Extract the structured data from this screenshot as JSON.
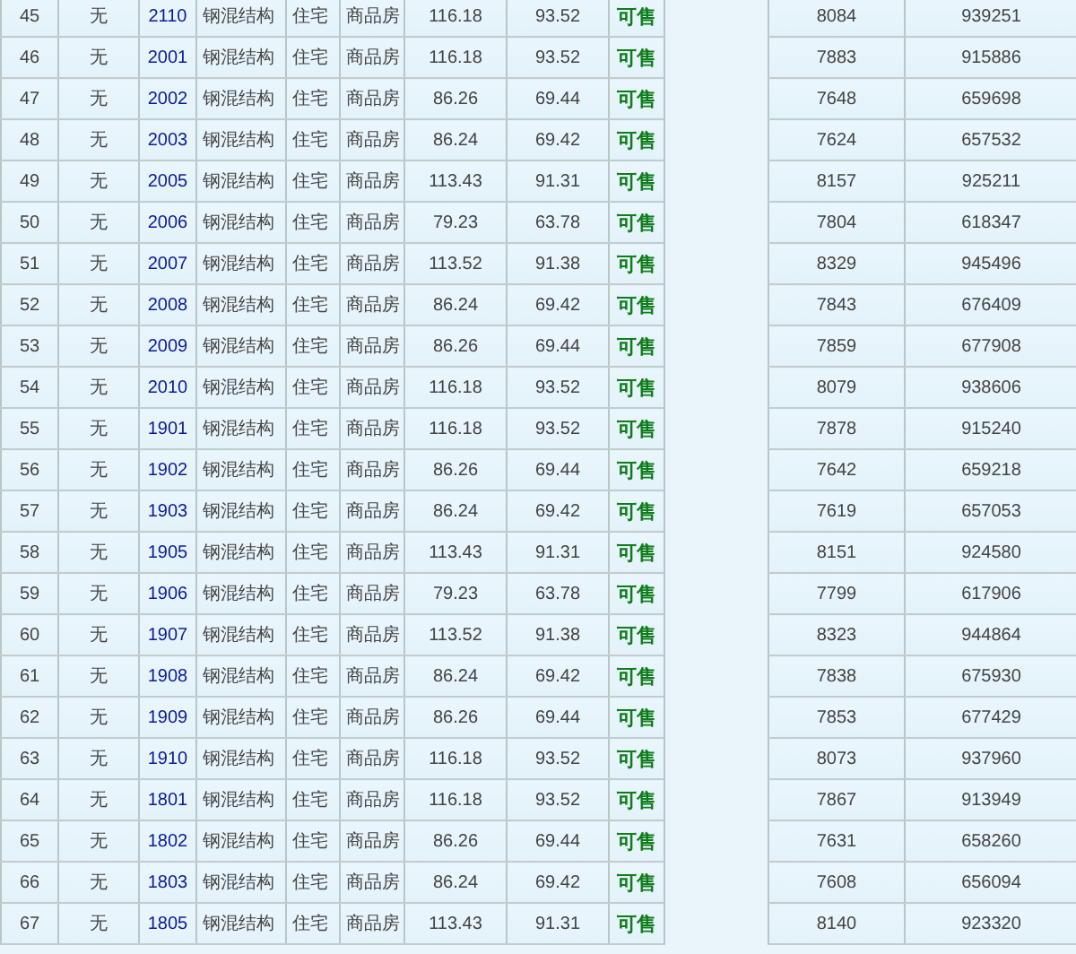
{
  "table": {
    "rows": [
      {
        "cells": [
          "45",
          "无",
          "2110",
          "钢混结构",
          "住宅",
          "商品房",
          "116.18",
          "93.52",
          "可售",
          "8084",
          "939251"
        ]
      },
      {
        "cells": [
          "46",
          "无",
          "2001",
          "钢混结构",
          "住宅",
          "商品房",
          "116.18",
          "93.52",
          "可售",
          "7883",
          "915886"
        ]
      },
      {
        "cells": [
          "47",
          "无",
          "2002",
          "钢混结构",
          "住宅",
          "商品房",
          "86.26",
          "69.44",
          "可售",
          "7648",
          "659698"
        ]
      },
      {
        "cells": [
          "48",
          "无",
          "2003",
          "钢混结构",
          "住宅",
          "商品房",
          "86.24",
          "69.42",
          "可售",
          "7624",
          "657532"
        ]
      },
      {
        "cells": [
          "49",
          "无",
          "2005",
          "钢混结构",
          "住宅",
          "商品房",
          "113.43",
          "91.31",
          "可售",
          "8157",
          "925211"
        ]
      },
      {
        "cells": [
          "50",
          "无",
          "2006",
          "钢混结构",
          "住宅",
          "商品房",
          "79.23",
          "63.78",
          "可售",
          "7804",
          "618347"
        ]
      },
      {
        "cells": [
          "51",
          "无",
          "2007",
          "钢混结构",
          "住宅",
          "商品房",
          "113.52",
          "91.38",
          "可售",
          "8329",
          "945496"
        ]
      },
      {
        "cells": [
          "52",
          "无",
          "2008",
          "钢混结构",
          "住宅",
          "商品房",
          "86.24",
          "69.42",
          "可售",
          "7843",
          "676409"
        ]
      },
      {
        "cells": [
          "53",
          "无",
          "2009",
          "钢混结构",
          "住宅",
          "商品房",
          "86.26",
          "69.44",
          "可售",
          "7859",
          "677908"
        ]
      },
      {
        "cells": [
          "54",
          "无",
          "2010",
          "钢混结构",
          "住宅",
          "商品房",
          "116.18",
          "93.52",
          "可售",
          "8079",
          "938606"
        ]
      },
      {
        "cells": [
          "55",
          "无",
          "1901",
          "钢混结构",
          "住宅",
          "商品房",
          "116.18",
          "93.52",
          "可售",
          "7878",
          "915240"
        ]
      },
      {
        "cells": [
          "56",
          "无",
          "1902",
          "钢混结构",
          "住宅",
          "商品房",
          "86.26",
          "69.44",
          "可售",
          "7642",
          "659218"
        ]
      },
      {
        "cells": [
          "57",
          "无",
          "1903",
          "钢混结构",
          "住宅",
          "商品房",
          "86.24",
          "69.42",
          "可售",
          "7619",
          "657053"
        ]
      },
      {
        "cells": [
          "58",
          "无",
          "1905",
          "钢混结构",
          "住宅",
          "商品房",
          "113.43",
          "91.31",
          "可售",
          "8151",
          "924580"
        ]
      },
      {
        "cells": [
          "59",
          "无",
          "1906",
          "钢混结构",
          "住宅",
          "商品房",
          "79.23",
          "63.78",
          "可售",
          "7799",
          "617906"
        ]
      },
      {
        "cells": [
          "60",
          "无",
          "1907",
          "钢混结构",
          "住宅",
          "商品房",
          "113.52",
          "91.38",
          "可售",
          "8323",
          "944864"
        ]
      },
      {
        "cells": [
          "61",
          "无",
          "1908",
          "钢混结构",
          "住宅",
          "商品房",
          "86.24",
          "69.42",
          "可售",
          "7838",
          "675930"
        ]
      },
      {
        "cells": [
          "62",
          "无",
          "1909",
          "钢混结构",
          "住宅",
          "商品房",
          "86.26",
          "69.44",
          "可售",
          "7853",
          "677429"
        ]
      },
      {
        "cells": [
          "63",
          "无",
          "1910",
          "钢混结构",
          "住宅",
          "商品房",
          "116.18",
          "93.52",
          "可售",
          "8073",
          "937960"
        ]
      },
      {
        "cells": [
          "64",
          "无",
          "1801",
          "钢混结构",
          "住宅",
          "商品房",
          "116.18",
          "93.52",
          "可售",
          "7867",
          "913949"
        ]
      },
      {
        "cells": [
          "65",
          "无",
          "1802",
          "钢混结构",
          "住宅",
          "商品房",
          "86.26",
          "69.44",
          "可售",
          "7631",
          "658260"
        ]
      },
      {
        "cells": [
          "66",
          "无",
          "1803",
          "钢混结构",
          "住宅",
          "商品房",
          "86.24",
          "69.42",
          "可售",
          "7608",
          "656094"
        ]
      },
      {
        "cells": [
          "67",
          "无",
          "1805",
          "钢混结构",
          "住宅",
          "商品房",
          "113.43",
          "91.31",
          "可售",
          "8140",
          "923320"
        ]
      }
    ]
  }
}
